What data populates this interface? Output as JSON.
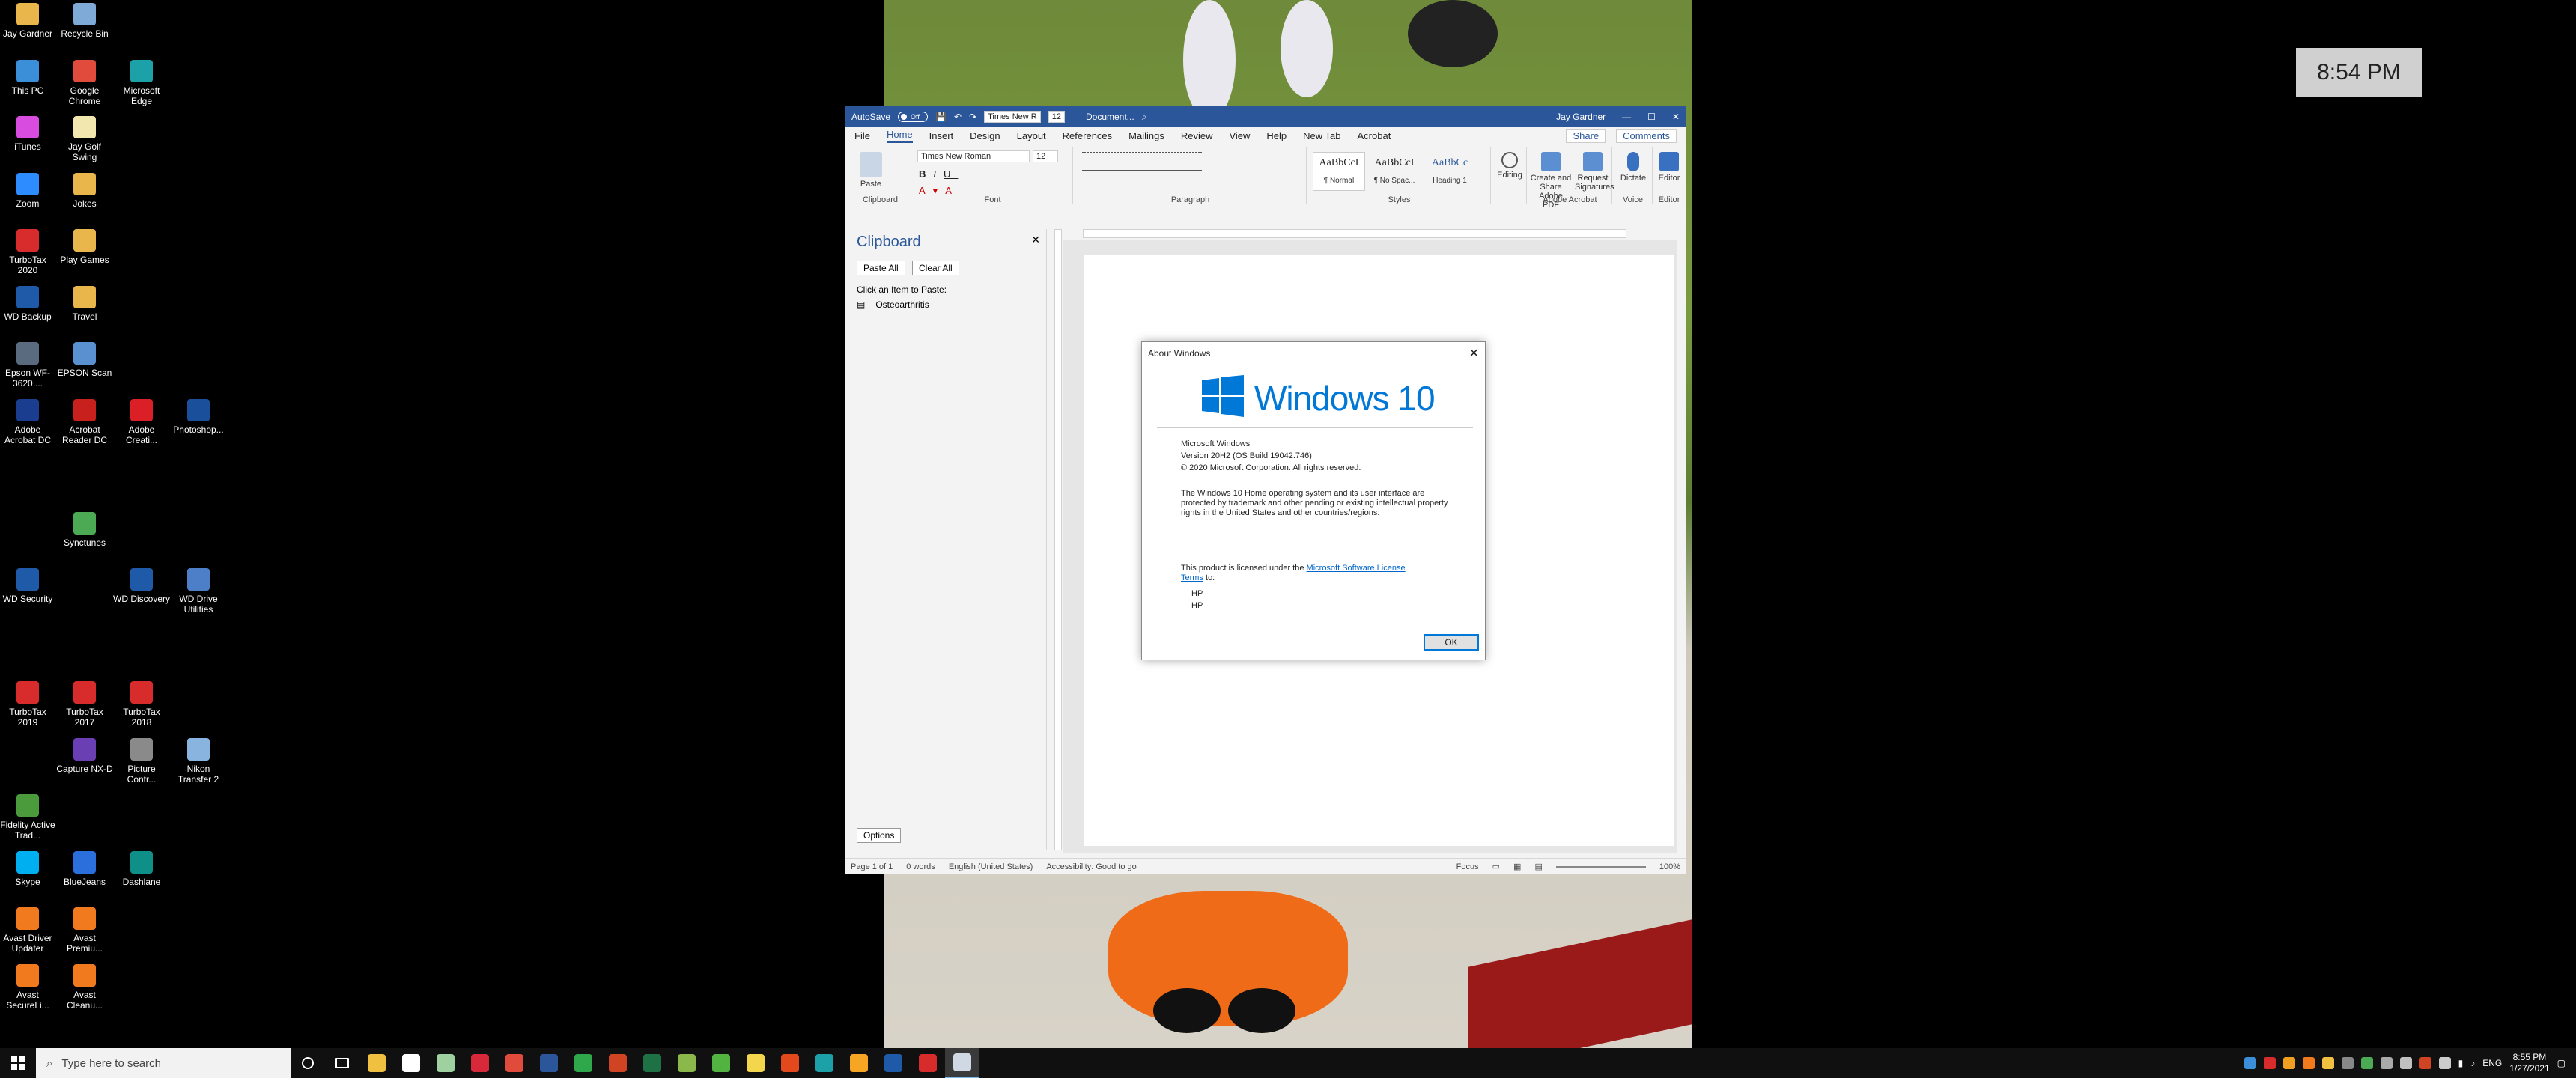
{
  "desktop": {
    "clock_tile": "8:54 PM",
    "icons": [
      {
        "label": "Jay Gardner",
        "icon": "folder-icon",
        "color": "#e8b64a"
      },
      {
        "label": "Recycle Bin",
        "icon": "recycle-bin-icon",
        "color": "#7fa9d6"
      },
      {
        "label": "This PC",
        "icon": "computer-icon",
        "color": "#3a8fd8"
      },
      {
        "label": "Google Chrome",
        "icon": "chrome-icon",
        "color": "#e04b3c"
      },
      {
        "label": "Microsoft Edge",
        "icon": "edge-icon",
        "color": "#1da1a8"
      },
      {
        "label": "iTunes",
        "icon": "itunes-icon",
        "color": "#d84ce0"
      },
      {
        "label": "Jay Golf Swing",
        "icon": "file-icon",
        "color": "#f3e7b0"
      },
      {
        "label": "Zoom",
        "icon": "zoom-icon",
        "color": "#2d8cff"
      },
      {
        "label": "Jokes",
        "icon": "folder-icon",
        "color": "#e8b64a"
      },
      {
        "label": "TurboTax 2020",
        "icon": "turbotax-icon",
        "color": "#d82b2b"
      },
      {
        "label": "Play Games",
        "icon": "folder-icon",
        "color": "#e8b64a"
      },
      {
        "label": "WD Backup",
        "icon": "wd-backup-icon",
        "color": "#1f5aa8"
      },
      {
        "label": "Travel",
        "icon": "folder-icon",
        "color": "#e8b64a"
      },
      {
        "label": "Epson WF-3620 ...",
        "icon": "printer-icon",
        "color": "#5a6b80"
      },
      {
        "label": "EPSON Scan",
        "icon": "scanner-icon",
        "color": "#5a8fd0"
      },
      {
        "label": "Adobe Acrobat DC",
        "icon": "acrobat-icon",
        "color": "#1a3d8f"
      },
      {
        "label": "Acrobat Reader DC",
        "icon": "acrobat-reader-icon",
        "color": "#c8201c"
      },
      {
        "label": "Adobe Creati...",
        "icon": "creative-cloud-icon",
        "color": "#da1f26"
      },
      {
        "label": "Photoshop...",
        "icon": "photoshop-icon",
        "color": "#1a4f9c"
      },
      {
        "label": "Synctunes",
        "icon": "sync-icon",
        "color": "#4caa55"
      },
      {
        "label": "WD Security",
        "icon": "wd-security-icon",
        "color": "#1f5aa8"
      },
      {
        "label": "WD Discovery",
        "icon": "wd-discovery-icon",
        "color": "#1f5aa8"
      },
      {
        "label": "WD Drive Utilities",
        "icon": "wd-utilities-icon",
        "color": "#4d7fc9"
      },
      {
        "label": "TurboTax 2019",
        "icon": "turbotax-icon",
        "color": "#d82b2b"
      },
      {
        "label": "TurboTax 2017",
        "icon": "turbotax-icon",
        "color": "#d82b2b"
      },
      {
        "label": "TurboTax 2018",
        "icon": "turbotax-icon",
        "color": "#d82b2b"
      },
      {
        "label": "Capture NX-D",
        "icon": "capture-icon",
        "color": "#6a3fb4"
      },
      {
        "label": "Picture Contr...",
        "icon": "picture-control-icon",
        "color": "#8a8a8a"
      },
      {
        "label": "Nikon Transfer 2",
        "icon": "nikon-icon",
        "color": "#8ab4e0"
      },
      {
        "label": "Fidelity Active Trad...",
        "icon": "fidelity-icon",
        "color": "#4b9b3d"
      },
      {
        "label": "Skype",
        "icon": "skype-icon",
        "color": "#00aff0"
      },
      {
        "label": "BlueJeans",
        "icon": "bluejeans-icon",
        "color": "#2a6fdb"
      },
      {
        "label": "Dashlane",
        "icon": "dashlane-icon",
        "color": "#0e8f88"
      },
      {
        "label": "Avast Driver Updater",
        "icon": "avast-icon",
        "color": "#f07a1d"
      },
      {
        "label": "Avast Premiu...",
        "icon": "avast-icon",
        "color": "#f07a1d"
      },
      {
        "label": "Avast SecureLi...",
        "icon": "avast-icon",
        "color": "#f07a1d"
      },
      {
        "label": "Avast Cleanu...",
        "icon": "avast-icon",
        "color": "#f07a1d"
      }
    ]
  },
  "word": {
    "autosave_label": "AutoSave",
    "autosave_state": "Off",
    "font_box": "Times New R",
    "size_box": "12",
    "doc_title": "Document...",
    "user": "Jay Gardner",
    "menu": [
      "File",
      "Home",
      "Insert",
      "Design",
      "Layout",
      "References",
      "Mailings",
      "Review",
      "View",
      "Help",
      "New Tab",
      "Acrobat"
    ],
    "active_menu": "Home",
    "share": "Share",
    "comments": "Comments",
    "ribbon": {
      "paste": "Paste",
      "font_name": "Times New Roman",
      "font_size": "12",
      "styles": [
        {
          "preview": "AaBbCcI",
          "name": "¶ Normal"
        },
        {
          "preview": "AaBbCcI",
          "name": "¶ No Spac..."
        },
        {
          "preview": "AaBbCc",
          "name": "Heading 1"
        }
      ],
      "editing": "Editing",
      "create_share_pdf": "Create and Share Adobe PDF",
      "request_signatures": "Request Signatures",
      "dictate": "Dictate",
      "editor": "Editor",
      "groups": [
        "Clipboard",
        "Font",
        "Paragraph",
        "Styles",
        "Adobe Acrobat",
        "Voice",
        "Editor"
      ]
    },
    "clipboard_pane": {
      "title": "Clipboard",
      "paste_all": "Paste All",
      "clear_all": "Clear All",
      "hint": "Click an Item to Paste:",
      "items": [
        "Osteoarthritis"
      ],
      "options": "Options"
    },
    "status": {
      "page": "Page 1 of 1",
      "words": "0 words",
      "language": "English (United States)",
      "accessibility": "Accessibility: Good to go",
      "focus": "Focus",
      "zoom": "100%"
    }
  },
  "about": {
    "title": "About Windows",
    "logo_text": "Windows 10",
    "line1": "Microsoft Windows",
    "line2": "Version 20H2 (OS Build 19042.746)",
    "line3": "© 2020 Microsoft Corporation. All rights reserved.",
    "para": "The Windows 10 Home operating system and its user interface are protected by trademark and other pending or existing intellectual property rights in the United States and other countries/regions.",
    "license_pre": "This product is licensed under the ",
    "license_link": "Microsoft Software License Terms",
    "license_post": " to:",
    "licensee1": "HP",
    "licensee2": "HP",
    "ok": "OK"
  },
  "taskbar": {
    "search_placeholder": "Type here to search",
    "apps": [
      {
        "name": "file-explorer-icon",
        "color": "#f0c040"
      },
      {
        "name": "store-icon",
        "color": "#ffffff"
      },
      {
        "name": "mobile-icon",
        "color": "#9fd0a0"
      },
      {
        "name": "quicken-icon",
        "color": "#d8293a"
      },
      {
        "name": "chrome-icon",
        "color": "#e04b3c"
      },
      {
        "name": "word-icon",
        "color": "#2b579a"
      },
      {
        "name": "defender-icon",
        "color": "#2ea84a"
      },
      {
        "name": "powerpoint-icon",
        "color": "#d04423"
      },
      {
        "name": "excel-icon",
        "color": "#1e7145"
      },
      {
        "name": "wheel-icon",
        "color": "#8bb84a"
      },
      {
        "name": "greenshot-icon",
        "color": "#53b340"
      },
      {
        "name": "sticky-notes-icon",
        "color": "#f3d64b"
      },
      {
        "name": "office-icon",
        "color": "#e3491d"
      },
      {
        "name": "edge-icon",
        "color": "#1da1a8"
      },
      {
        "name": "weather-icon",
        "color": "#f6a623"
      },
      {
        "name": "wd-icon",
        "color": "#1f5aa8"
      },
      {
        "name": "turbotax-icon",
        "color": "#d82b2b"
      },
      {
        "name": "about-windows-icon",
        "color": "#cfd8e3"
      }
    ],
    "lang": "ENG",
    "time": "8:55 PM",
    "date": "1/27/2021"
  }
}
